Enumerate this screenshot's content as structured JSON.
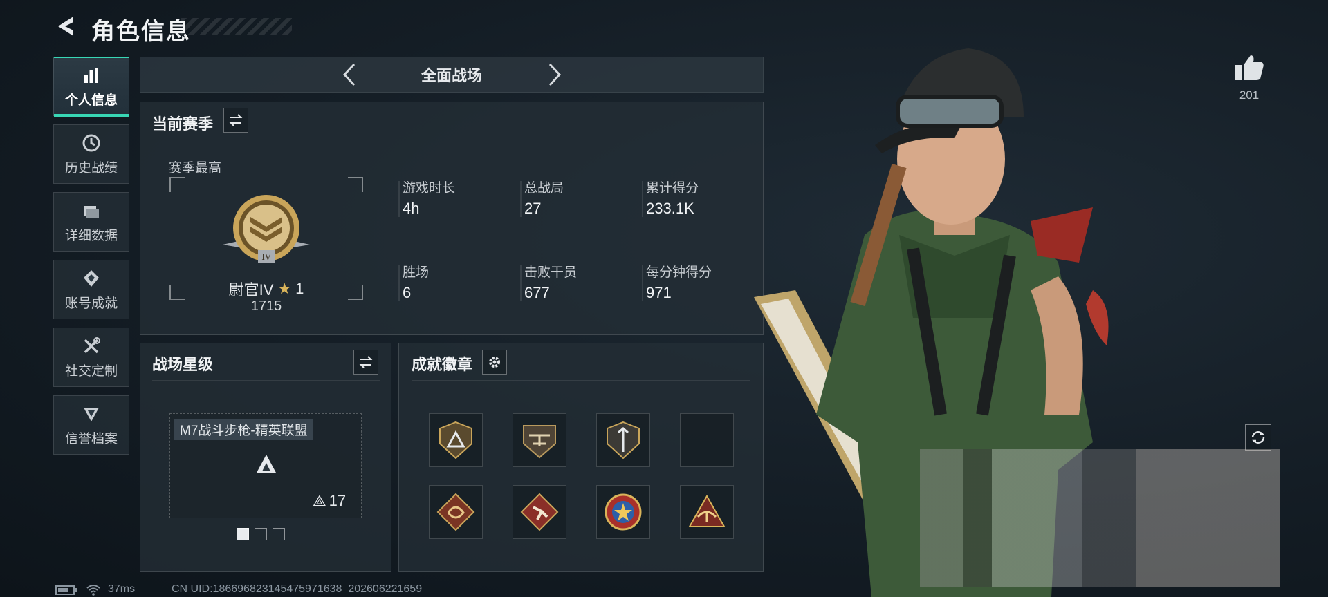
{
  "header": {
    "title": "角色信息"
  },
  "sidebar": {
    "items": [
      {
        "label": "个人信息",
        "icon": "bar-chart-icon",
        "active": true
      },
      {
        "label": "历史战绩",
        "icon": "clock-icon",
        "active": false
      },
      {
        "label": "详细数据",
        "icon": "folders-icon",
        "active": false
      },
      {
        "label": "账号成就",
        "icon": "achievement-icon",
        "active": false
      },
      {
        "label": "社交定制",
        "icon": "tools-icon",
        "active": false
      },
      {
        "label": "信誉档案",
        "icon": "credit-badge-icon",
        "active": false
      }
    ]
  },
  "mode": {
    "title": "全面战场"
  },
  "season": {
    "title": "当前赛季",
    "best_label": "赛季最高",
    "rank_name": "尉官IV",
    "rank_stars": "1",
    "rank_score": "1715",
    "rank_numeral": "IV",
    "stats": [
      {
        "label": "游戏时长",
        "value": "4h"
      },
      {
        "label": "总战局",
        "value": "27"
      },
      {
        "label": "累计得分",
        "value": "233.1K"
      },
      {
        "label": "胜场",
        "value": "6"
      },
      {
        "label": "击败干员",
        "value": "677"
      },
      {
        "label": "每分钟得分",
        "value": "971"
      }
    ]
  },
  "star_level": {
    "title": "战场星级",
    "weapon_name": "M7战斗步枪-精英联盟",
    "weapon_stars": "17",
    "page_count": 3,
    "current_page": 1
  },
  "medals": {
    "title": "成就徽章",
    "items": [
      {
        "icon": "triangle-shield-medal-icon"
      },
      {
        "icon": "helicopter-shield-medal-icon"
      },
      {
        "icon": "sword-shield-medal-icon"
      },
      {
        "icon": "empty-slot"
      },
      {
        "icon": "dragon-diamond-medal-icon"
      },
      {
        "icon": "runner-diamond-medal-icon"
      },
      {
        "icon": "star-round-medal-icon"
      },
      {
        "icon": "eagle-triangle-medal-icon"
      }
    ]
  },
  "likes": {
    "count": "201"
  },
  "status": {
    "ping": "37ms",
    "uid": "CN UID:18669682314547597163​8_202606221659"
  },
  "colors": {
    "accent": "#38d7b5",
    "gold": "#c9a55a",
    "panel": "#24303a"
  }
}
